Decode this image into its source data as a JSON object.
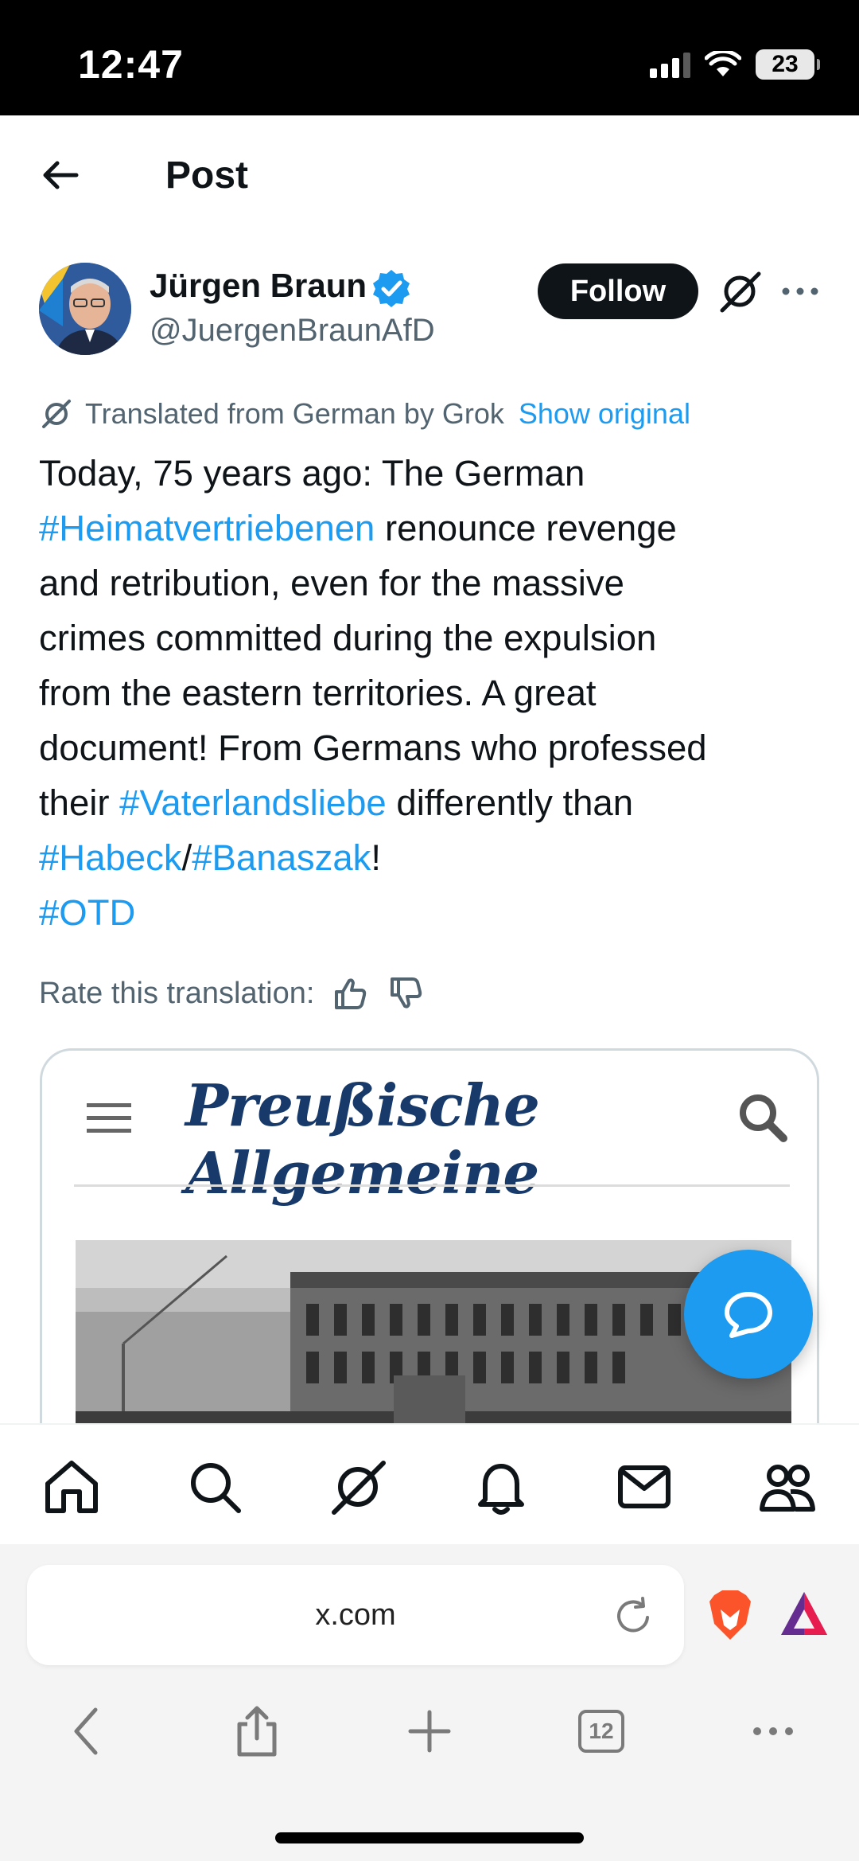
{
  "status_bar": {
    "time": "12:47",
    "battery": "23"
  },
  "header": {
    "title": "Post"
  },
  "author": {
    "name": "Jürgen Braun",
    "handle": "@JuergenBraunAfD",
    "follow_label": "Follow"
  },
  "translation": {
    "label": "Translated from German by Grok",
    "show_original": "Show original",
    "rate_label": "Rate this translation:"
  },
  "post": {
    "segments": [
      {
        "text": "Today, 75 years ago: The German\n",
        "tag": false
      },
      {
        "text": "#Heimatvertriebenen",
        "tag": true
      },
      {
        "text": " renounce revenge\nand retribution, even for the massive\ncrimes committed during the expulsion\nfrom the eastern territories. A great\ndocument! From Germans who professed\ntheir ",
        "tag": false
      },
      {
        "text": "#Vaterlandsliebe",
        "tag": true
      },
      {
        "text": " differently than\n",
        "tag": false
      },
      {
        "text": "#Habeck",
        "tag": true
      },
      {
        "text": "/",
        "tag": false
      },
      {
        "text": "#Banaszak",
        "tag": true
      },
      {
        "text": "!\n",
        "tag": false
      },
      {
        "text": "#OTD",
        "tag": true
      }
    ]
  },
  "media_card": {
    "brand": "Preußische Allgemeine"
  },
  "bottom_nav": {
    "items": [
      "home-icon",
      "search-icon",
      "grok-icon",
      "notifications-icon",
      "messages-icon",
      "communities-icon"
    ]
  },
  "browser": {
    "url": "x.com",
    "tab_count": "12"
  },
  "colors": {
    "accent": "#1d9bf0",
    "text": "#0f1419",
    "secondary": "#536471"
  }
}
